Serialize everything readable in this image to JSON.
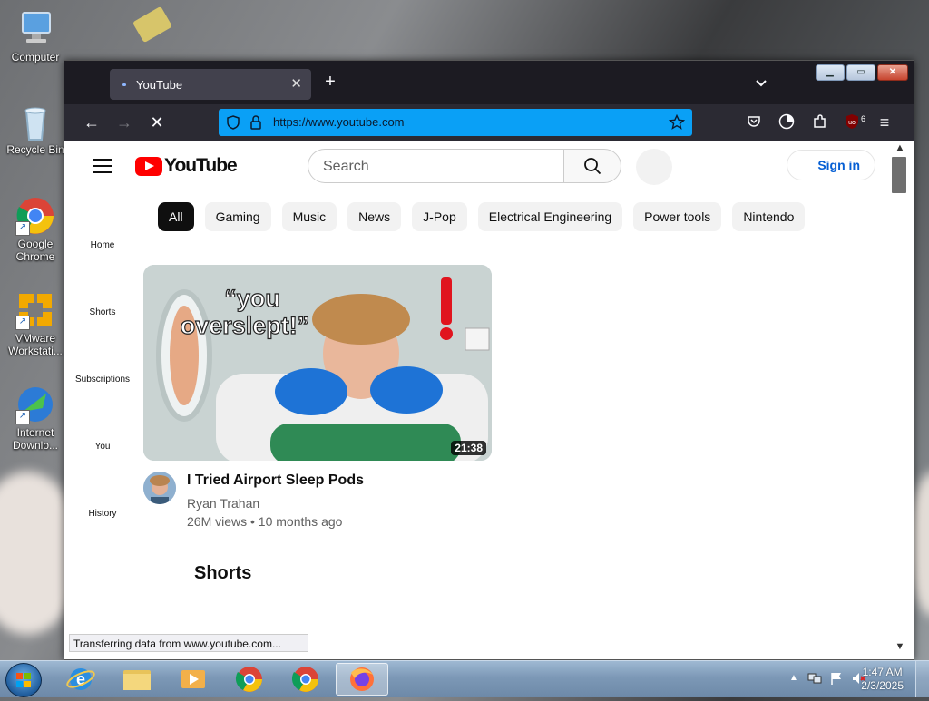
{
  "desktop": {
    "icons": [
      {
        "label": "Computer"
      },
      {
        "label": "Recycle Bin"
      },
      {
        "label": "Google Chrome"
      },
      {
        "label": "VMware Workstati..."
      },
      {
        "label": "Internet Downlo..."
      }
    ]
  },
  "browser": {
    "tab": {
      "title": "YouTube"
    },
    "url": "https://www.youtube.com",
    "extension_badge": "6"
  },
  "youtube": {
    "search_placeholder": "Search",
    "signin_label": "Sign in",
    "chips": [
      "All",
      "Gaming",
      "Music",
      "News",
      "J-Pop",
      "Electrical Engineering",
      "Power tools",
      "Nintendo"
    ],
    "sidebar": [
      "Home",
      "Shorts",
      "Subscriptions",
      "You",
      "History"
    ],
    "video": {
      "thumbnail_text_line1": "“you",
      "thumbnail_text_line2": "overslept!”",
      "duration": "21:38",
      "title": "I Tried Airport Sleep Pods",
      "channel": "Ryan Trahan",
      "meta": "26M views • 10 months ago"
    },
    "shorts_heading": "Shorts"
  },
  "status_text": "Transferring data from www.youtube.com...",
  "taskbar": {
    "time": "1:47 AM",
    "date": "2/3/2025"
  }
}
